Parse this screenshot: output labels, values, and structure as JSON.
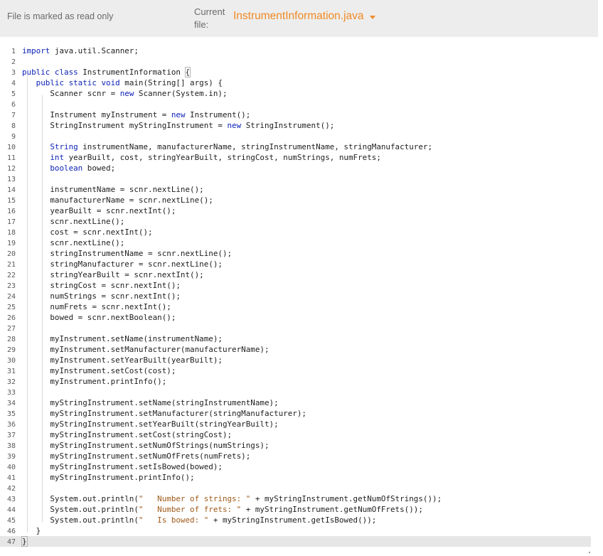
{
  "toolbar": {
    "readonly_notice": "File is marked as read only",
    "current_file_label": "Current file:",
    "current_file_name": "InstrumentInformation.java"
  },
  "editor": {
    "active_line": 47,
    "lines": [
      {
        "n": "1",
        "segs": [
          [
            "kw",
            "import"
          ],
          [
            "",
            " java.util.Scanner;"
          ]
        ]
      },
      {
        "n": "2",
        "segs": []
      },
      {
        "n": "3",
        "segs": [
          [
            "kw",
            "public class"
          ],
          [
            "",
            " InstrumentInformation "
          ],
          [
            "box",
            "{"
          ]
        ]
      },
      {
        "n": "4",
        "segs": [
          [
            "",
            "   "
          ],
          [
            "kw",
            "public static void"
          ],
          [
            "",
            " main(String[] args) {"
          ]
        ]
      },
      {
        "n": "5",
        "segs": [
          [
            "",
            "      Scanner scnr = "
          ],
          [
            "kw",
            "new"
          ],
          [
            "",
            " Scanner(System.in);"
          ]
        ]
      },
      {
        "n": "6",
        "segs": []
      },
      {
        "n": "7",
        "segs": [
          [
            "",
            "      Instrument myInstrument = "
          ],
          [
            "kw",
            "new"
          ],
          [
            "",
            " Instrument();"
          ]
        ]
      },
      {
        "n": "8",
        "segs": [
          [
            "",
            "      StringInstrument myStringInstrument = "
          ],
          [
            "kw",
            "new"
          ],
          [
            "",
            " StringInstrument();"
          ]
        ]
      },
      {
        "n": "9",
        "segs": []
      },
      {
        "n": "10",
        "segs": [
          [
            "",
            "      "
          ],
          [
            "kw",
            "String"
          ],
          [
            "",
            " instrumentName, manufacturerName, stringInstrumentName, stringManufacturer;"
          ]
        ]
      },
      {
        "n": "11",
        "segs": [
          [
            "",
            "      "
          ],
          [
            "kw",
            "int"
          ],
          [
            "",
            " yearBuilt, cost, stringYearBuilt, stringCost, numStrings, numFrets;"
          ]
        ]
      },
      {
        "n": "12",
        "segs": [
          [
            "",
            "      "
          ],
          [
            "kw",
            "boolean"
          ],
          [
            "",
            " bowed;"
          ]
        ]
      },
      {
        "n": "13",
        "segs": []
      },
      {
        "n": "14",
        "segs": [
          [
            "",
            "      instrumentName = scnr.nextLine();"
          ]
        ]
      },
      {
        "n": "15",
        "segs": [
          [
            "",
            "      manufacturerName = scnr.nextLine();"
          ]
        ]
      },
      {
        "n": "16",
        "segs": [
          [
            "",
            "      yearBuilt = scnr.nextInt();"
          ]
        ]
      },
      {
        "n": "17",
        "segs": [
          [
            "",
            "      scnr.nextLine();"
          ]
        ]
      },
      {
        "n": "18",
        "segs": [
          [
            "",
            "      cost = scnr.nextInt();"
          ]
        ]
      },
      {
        "n": "19",
        "segs": [
          [
            "",
            "      scnr.nextLine();"
          ]
        ]
      },
      {
        "n": "20",
        "segs": [
          [
            "",
            "      stringInstrumentName = scnr.nextLine();"
          ]
        ]
      },
      {
        "n": "21",
        "segs": [
          [
            "",
            "      stringManufacturer = scnr.nextLine();"
          ]
        ]
      },
      {
        "n": "22",
        "segs": [
          [
            "",
            "      stringYearBuilt = scnr.nextInt();"
          ]
        ]
      },
      {
        "n": "23",
        "segs": [
          [
            "",
            "      stringCost = scnr.nextInt();"
          ]
        ]
      },
      {
        "n": "24",
        "segs": [
          [
            "",
            "      numStrings = scnr.nextInt();"
          ]
        ]
      },
      {
        "n": "25",
        "segs": [
          [
            "",
            "      numFrets = scnr.nextInt();"
          ]
        ]
      },
      {
        "n": "26",
        "segs": [
          [
            "",
            "      bowed = scnr.nextBoolean();"
          ]
        ]
      },
      {
        "n": "27",
        "segs": []
      },
      {
        "n": "28",
        "segs": [
          [
            "",
            "      myInstrument.setName(instrumentName);"
          ]
        ]
      },
      {
        "n": "29",
        "segs": [
          [
            "",
            "      myInstrument.setManufacturer(manufacturerName);"
          ]
        ]
      },
      {
        "n": "30",
        "segs": [
          [
            "",
            "      myInstrument.setYearBuilt(yearBuilt);"
          ]
        ]
      },
      {
        "n": "31",
        "segs": [
          [
            "",
            "      myInstrument.setCost(cost);"
          ]
        ]
      },
      {
        "n": "32",
        "segs": [
          [
            "",
            "      myInstrument.printInfo();"
          ]
        ]
      },
      {
        "n": "33",
        "segs": []
      },
      {
        "n": "34",
        "segs": [
          [
            "",
            "      myStringInstrument.setName(stringInstrumentName);"
          ]
        ]
      },
      {
        "n": "35",
        "segs": [
          [
            "",
            "      myStringInstrument.setManufacturer(stringManufacturer);"
          ]
        ]
      },
      {
        "n": "36",
        "segs": [
          [
            "",
            "      myStringInstrument.setYearBuilt(stringYearBuilt);"
          ]
        ]
      },
      {
        "n": "37",
        "segs": [
          [
            "",
            "      myStringInstrument.setCost(stringCost);"
          ]
        ]
      },
      {
        "n": "38",
        "segs": [
          [
            "",
            "      myStringInstrument.setNumOfStrings(numStrings);"
          ]
        ]
      },
      {
        "n": "39",
        "segs": [
          [
            "",
            "      myStringInstrument.setNumOfFrets(numFrets);"
          ]
        ]
      },
      {
        "n": "40",
        "segs": [
          [
            "",
            "      myStringInstrument.setIsBowed(bowed);"
          ]
        ]
      },
      {
        "n": "41",
        "segs": [
          [
            "",
            "      myStringInstrument.printInfo();"
          ]
        ]
      },
      {
        "n": "42",
        "segs": []
      },
      {
        "n": "43",
        "segs": [
          [
            "",
            "      System.out.println("
          ],
          [
            "str",
            "\"   Number of strings: \""
          ],
          [
            "",
            " + myStringInstrument.getNumOfStrings());"
          ]
        ]
      },
      {
        "n": "44",
        "segs": [
          [
            "",
            "      System.out.println("
          ],
          [
            "str",
            "\"   Number of frets: \""
          ],
          [
            "",
            " + myStringInstrument.getNumOfFrets());"
          ]
        ]
      },
      {
        "n": "45",
        "segs": [
          [
            "",
            "      System.out.println("
          ],
          [
            "str",
            "\"   Is bowed: \""
          ],
          [
            "",
            " + myStringInstrument.getIsBowed());"
          ]
        ]
      },
      {
        "n": "46",
        "segs": [
          [
            "",
            "   }"
          ]
        ]
      },
      {
        "n": "47",
        "segs": [
          [
            "box",
            "}"
          ]
        ]
      }
    ]
  },
  "colors": {
    "accent": "#f08a24",
    "keyword": "#0d23b8",
    "string": "#a05a1a",
    "toolbar_bg": "#ededed",
    "active_line_bg": "#e6e6e6"
  }
}
